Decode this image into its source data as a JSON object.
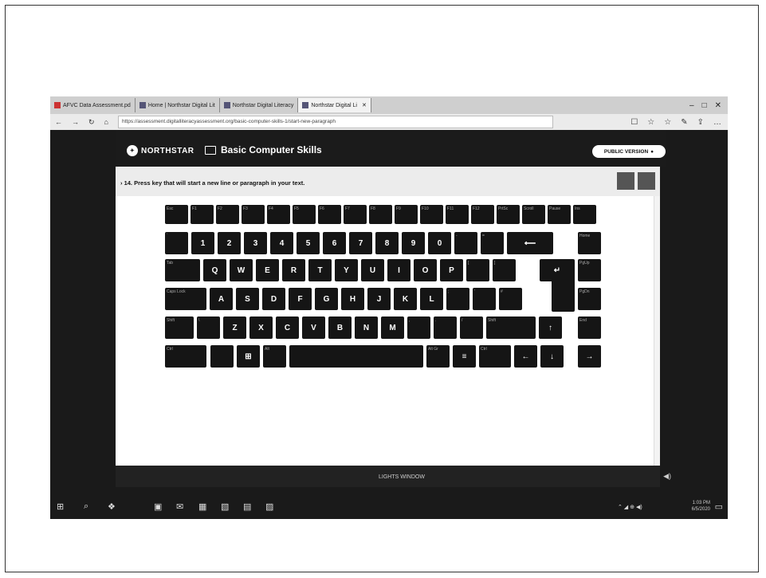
{
  "tabs": [
    {
      "label": "AFVC Data Assessment.pd",
      "active": false
    },
    {
      "label": "Home | Northstar Digital Lit",
      "active": false
    },
    {
      "label": "Northstar Digital Literacy",
      "active": false
    },
    {
      "label": "Northstar Digital Li",
      "active": true
    }
  ],
  "window_controls": [
    "–",
    "□",
    "✕"
  ],
  "address": {
    "url": "https://assessment.digitalliteracyassessment.org/basic-computer-skills-1/start-new-paragraph",
    "back": "←",
    "forward": "→",
    "refresh": "↻",
    "home": "⌂"
  },
  "toolbar_icons": [
    "☐",
    "☆",
    "☆",
    "✎",
    "⇪",
    "…"
  ],
  "app": {
    "brand": "NORTHSTAR",
    "course": "Basic Computer Skills",
    "public_version": "PUBLIC VERSION"
  },
  "question": {
    "text": "14. Press key that will start a new line or paragraph in your text."
  },
  "keyboard": {
    "row1": [
      "Esc",
      "F1",
      "F2",
      "F3",
      "F4",
      "F5",
      "F6",
      "F7",
      "F8",
      "F9",
      "F10",
      "F11",
      "F12",
      "PrtSc",
      "Scroll",
      "Pause",
      "Ins"
    ],
    "row2": [
      "`",
      "1",
      "2",
      "3",
      "4",
      "5",
      "6",
      "7",
      "8",
      "9",
      "0",
      "-",
      "=",
      "⟵",
      "Home"
    ],
    "row3": [
      "Tab",
      "Q",
      "W",
      "E",
      "R",
      "T",
      "Y",
      "U",
      "I",
      "O",
      "P",
      "[",
      "]",
      "↵",
      "PgUp"
    ],
    "row4": [
      "Caps Lock",
      "A",
      "S",
      "D",
      "F",
      "G",
      "H",
      "J",
      "K",
      "L",
      ";",
      "'",
      "#",
      "PgDn"
    ],
    "row5": [
      "Shift",
      "\\",
      "Z",
      "X",
      "C",
      "V",
      "B",
      "N",
      "M",
      ",",
      ".",
      "/",
      "Shift",
      "↑",
      "End"
    ],
    "row6": [
      "Ctrl",
      "",
      "⊞",
      "Alt",
      "",
      "Alt Gr",
      "≡",
      "Ctrl",
      "←",
      "↓",
      "→"
    ]
  },
  "footer": {
    "center": "LIGHTS WINDOW",
    "volume": "◀)"
  },
  "taskbar": {
    "icons": [
      "⊞",
      "⌕",
      "❖",
      "▣",
      "✉",
      "▦",
      "▧",
      "▤",
      "▨"
    ],
    "time": "1:03 PM",
    "date": "6/5/2020",
    "tray": "⌃ ◢ ⊕ ◀)",
    "notif": "▭"
  }
}
